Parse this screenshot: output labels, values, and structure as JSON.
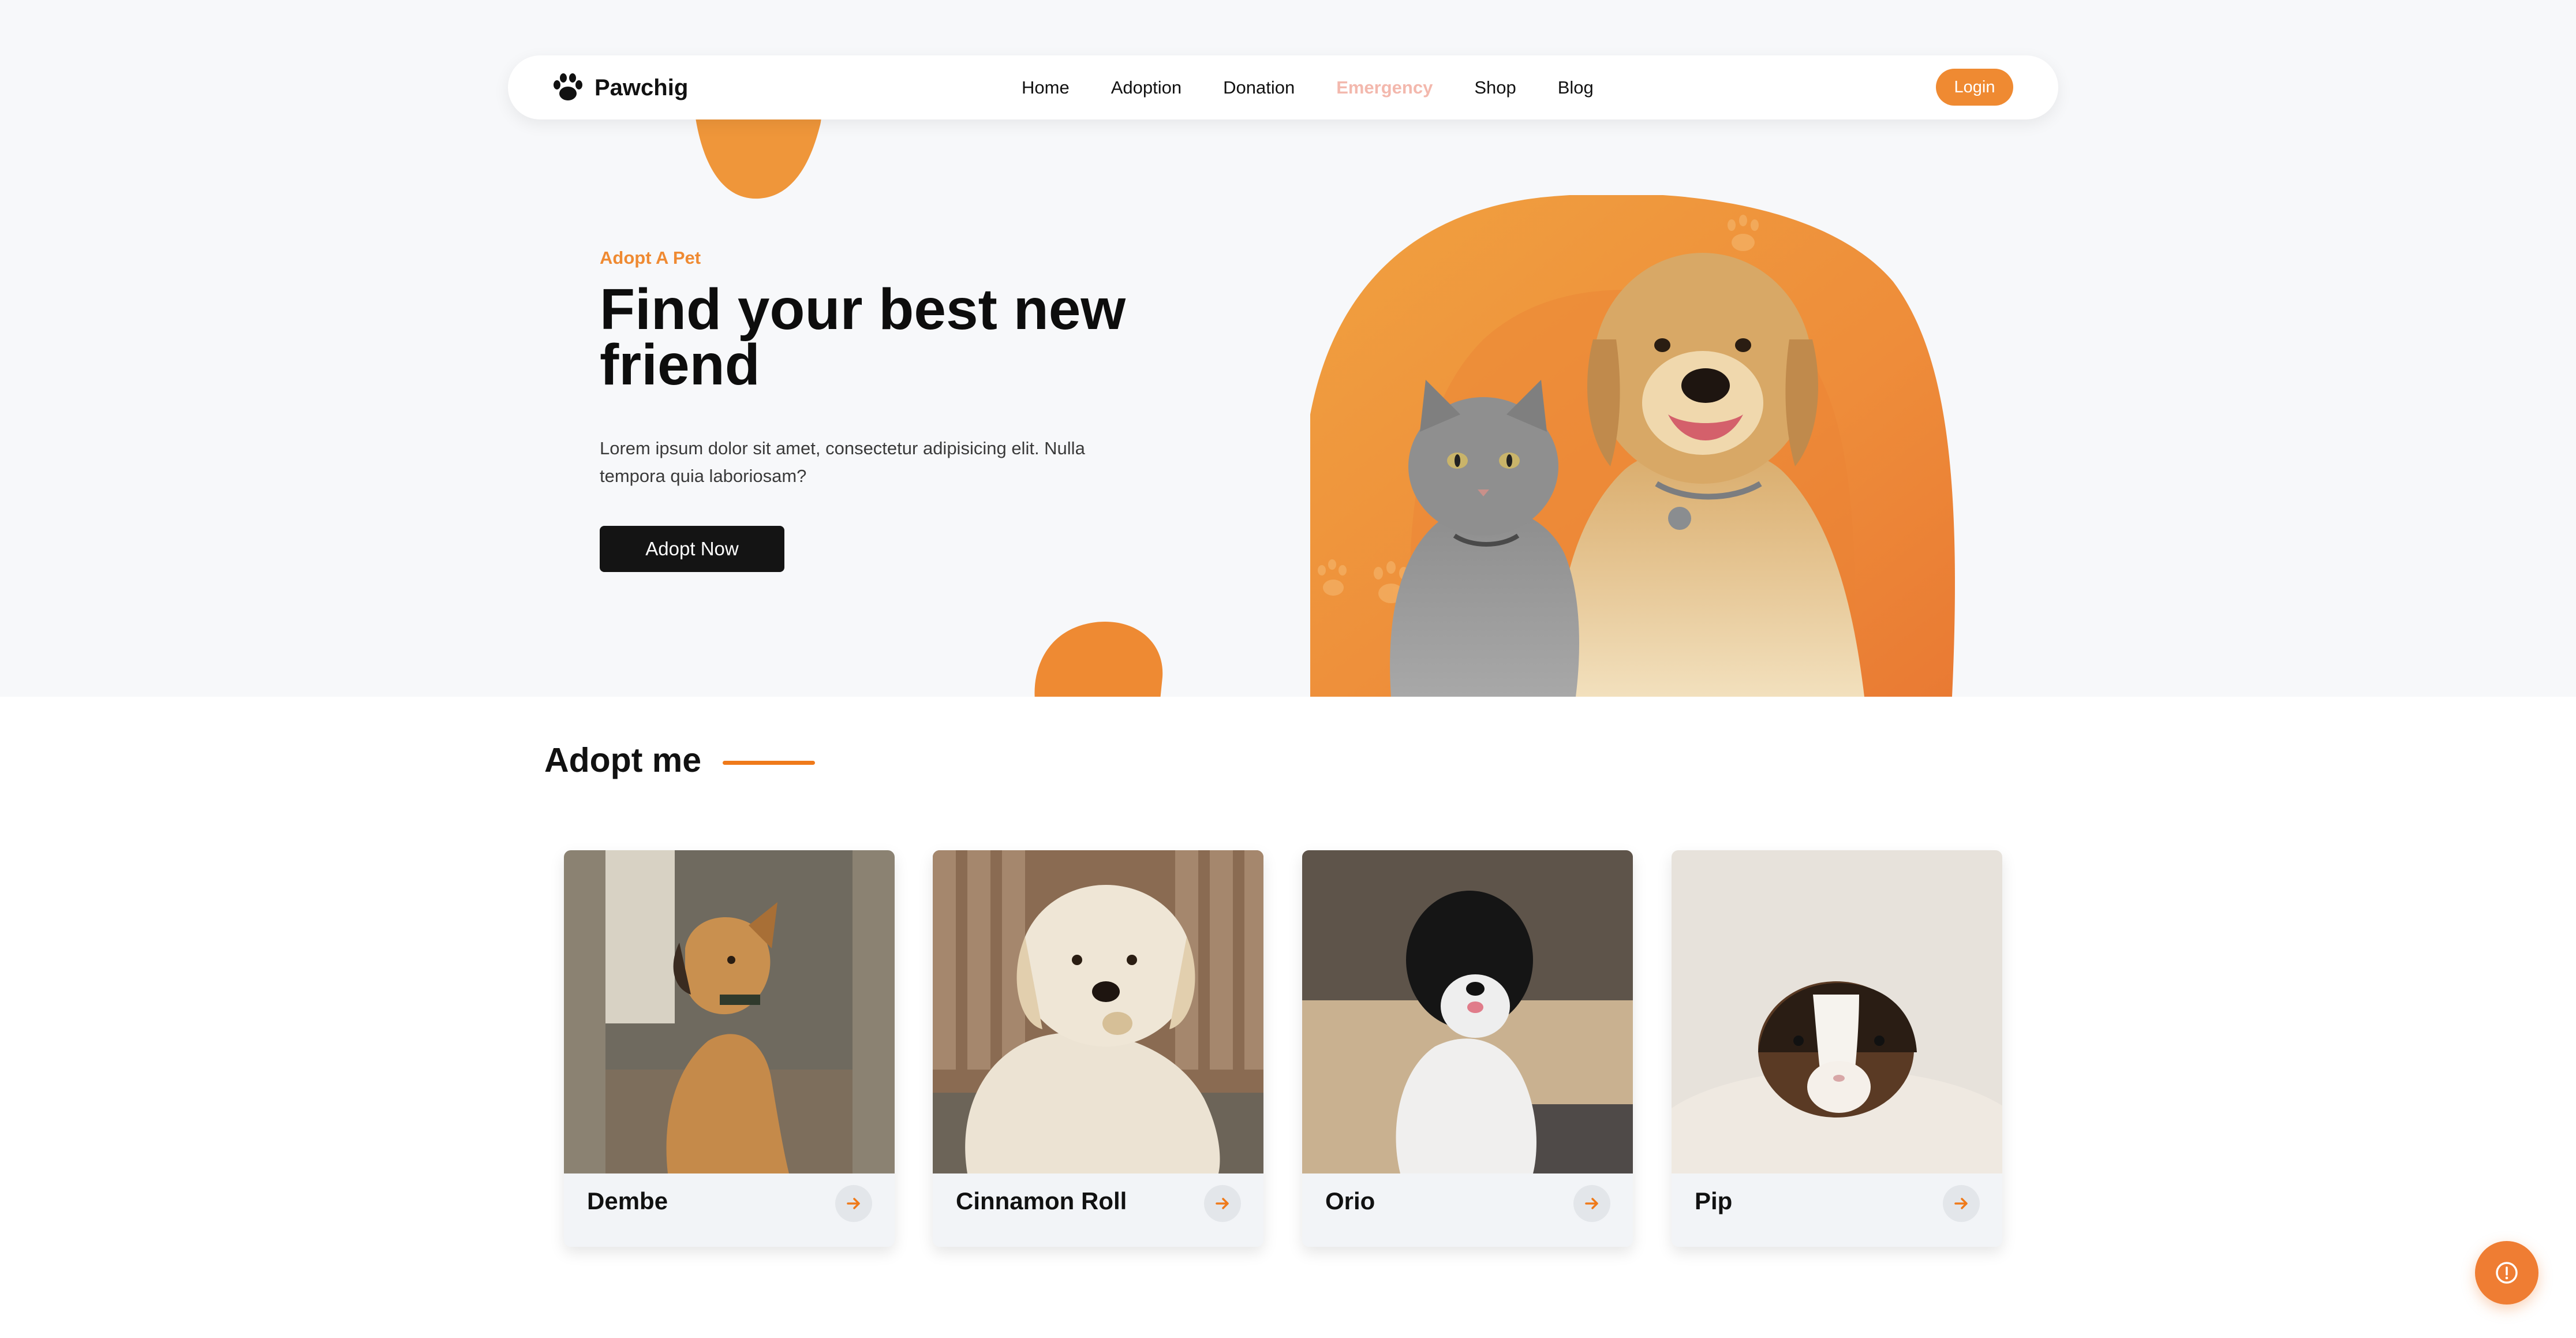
{
  "brand": {
    "name": "Pawchig",
    "logo_icon": "paw-icon"
  },
  "nav": {
    "links": [
      {
        "label": "Home"
      },
      {
        "label": "Adoption"
      },
      {
        "label": "Donation"
      },
      {
        "label": "Emergency",
        "active": true
      },
      {
        "label": "Shop"
      },
      {
        "label": "Blog"
      }
    ],
    "login_label": "Login"
  },
  "hero": {
    "eyebrow": "Adopt A Pet",
    "title": "Find your best new friend",
    "description": "Lorem ipsum dolor sit amet, consectetur adipisicing elit. Nulla tempora quia laboriosam?",
    "cta_label": "Adopt Now"
  },
  "adopt": {
    "title": "Adopt me",
    "pets": [
      {
        "name": "Dembe",
        "photo": "tan-puppy-photo"
      },
      {
        "name": "Cinnamon Roll",
        "photo": "fluffy-white-dog-photo"
      },
      {
        "name": "Orio",
        "photo": "black-white-puppy-photo"
      },
      {
        "name": "Pip",
        "photo": "guinea-pig-photo"
      }
    ],
    "arrow_icon": "arrow-right-icon"
  },
  "fab_icon": "info-circle-icon",
  "colors": {
    "accent": "#ef8a32",
    "accent_dark": "#ef7a1a",
    "active_nav": "#f3b8ad",
    "dark_button": "#141414",
    "hero_background": "#f7f8fa",
    "card_footer": "#f2f4f7"
  }
}
